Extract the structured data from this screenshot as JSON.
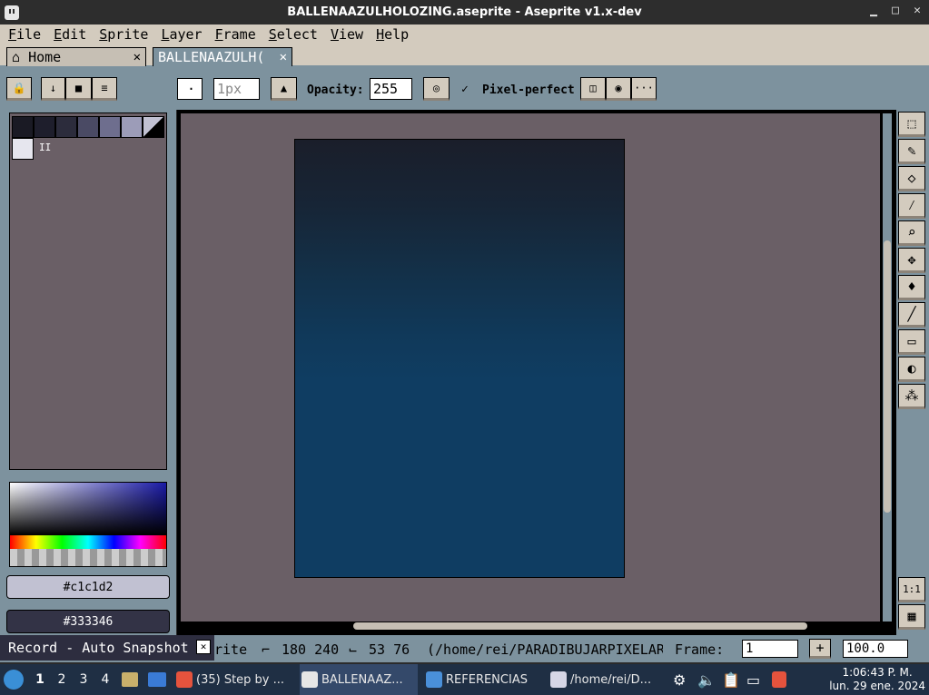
{
  "window": {
    "title": "BALLENAAZULHOLOZING.aseprite - Aseprite v1.x-dev"
  },
  "menu": [
    {
      "u": "F",
      "rest": "ile"
    },
    {
      "u": "E",
      "rest": "dit"
    },
    {
      "u": "S",
      "rest": "prite"
    },
    {
      "u": "L",
      "rest": "ayer"
    },
    {
      "u": "F",
      "rest": "rame"
    },
    {
      "u": "S",
      "rest": "elect"
    },
    {
      "u": "V",
      "rest": "iew"
    },
    {
      "u": "H",
      "rest": "elp"
    }
  ],
  "tabs": {
    "home": "Home",
    "active": "BALLENAAZULH("
  },
  "toolbar": {
    "brush_size": "1px",
    "opacity_label": "Opacity:",
    "opacity_value": "255",
    "pixel_perfect_label": "Pixel-perfect",
    "more": "···"
  },
  "palette": {
    "colors": [
      "#1a1a24",
      "#1e1e2c",
      "#2c2c3c",
      "#4a4a64",
      "#6e6e8e",
      "#9c9cb8",
      "#c1c1d2",
      "#e6e6ee"
    ],
    "index_label": "II"
  },
  "colors": {
    "foreground": "#c1c1d2",
    "background": "#333346"
  },
  "status": {
    "sprite_label": "rite",
    "size": "180 240",
    "position": "53 76",
    "path": "(/home/rei/PARADIBUJARPIXELAR",
    "frame_label": "Frame:",
    "frame_value": "1",
    "zoom_value": "100.0"
  },
  "record": {
    "label": "Record - Auto Snapshot"
  },
  "tools": {
    "zoom_ratio": "1:1"
  },
  "taskbar": {
    "workspaces": [
      "1",
      "2",
      "3",
      "4"
    ],
    "items": [
      "(35) Step by ...",
      "BALLENAAZ...",
      "REFERENCIAS",
      "/home/rei/D..."
    ],
    "time": "1:06:43 P. M.",
    "date": "lun. 29 ene. 2024"
  }
}
